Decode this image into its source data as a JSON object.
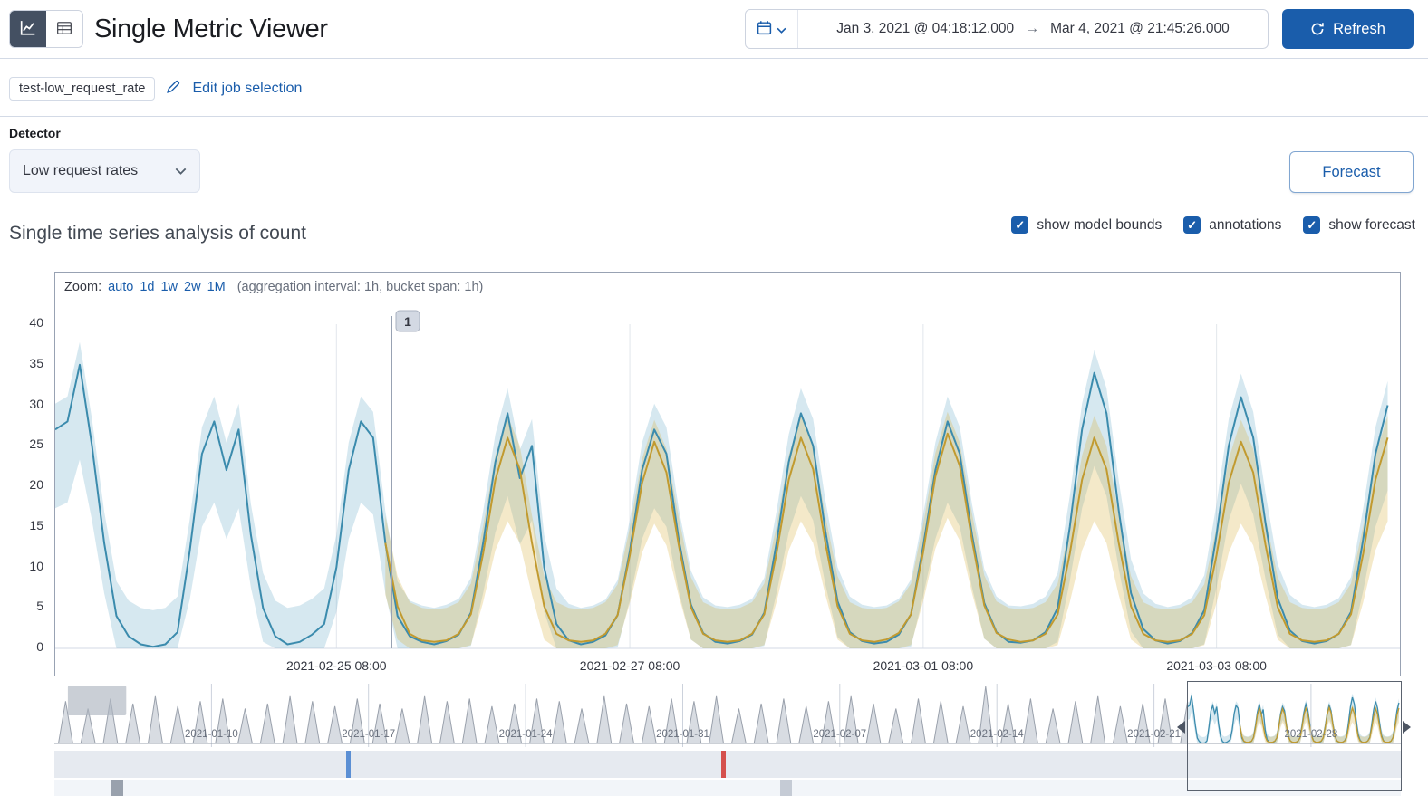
{
  "header": {
    "title": "Single Metric Viewer",
    "time_range": {
      "start": "Jan 3, 2021 @ 04:18:12.000",
      "arrow": "→",
      "end": "Mar 4, 2021 @ 21:45:26.000"
    },
    "refresh_label": "Refresh"
  },
  "job_bar": {
    "job_badge": "test-low_request_rate",
    "edit_link": "Edit job selection"
  },
  "detector": {
    "label": "Detector",
    "selected": "Low request rates"
  },
  "forecast_button_label": "Forecast",
  "series_section": {
    "title": "Single time series analysis of count",
    "checkboxes": [
      {
        "label": "show model bounds",
        "checked": true
      },
      {
        "label": "annotations",
        "checked": true
      },
      {
        "label": "show forecast",
        "checked": true
      }
    ]
  },
  "zoom_bar": {
    "prefix": "Zoom:",
    "links": [
      "auto",
      "1d",
      "1w",
      "2w",
      "1M"
    ],
    "suffix": "(aggregation interval: 1h, bucket span: 1h)"
  },
  "annotation": {
    "badge_label": "1"
  },
  "colors": {
    "primary": "#1a5dab",
    "actual_line": "#3b8bad",
    "model_band": "rgba(93,165,195,0.25)",
    "forecast_line": "#c19a2f",
    "forecast_band": "rgba(214,177,62,0.28)",
    "annotation_line": "#98a2b3",
    "gridline": "#e2e6ec",
    "context_fill": "#d8dce2",
    "context_stroke": "#9aa1ac",
    "marker_blue": "#5b8fd4",
    "marker_red": "#d5504c"
  },
  "chart_data": {
    "type": "line",
    "title": "Single time series analysis of count",
    "x_unit": "hours (bucket span 1h), window ≈ 2021-02-23 10:00 to 2021-03-04 16:00",
    "ylim": [
      0,
      40
    ],
    "y_ticks": [
      0,
      5,
      10,
      15,
      20,
      25,
      30,
      35,
      40
    ],
    "t_start": 0,
    "t_end": 220,
    "t_step": 2,
    "annotation_t": 55,
    "x_ticks": [
      {
        "t": 46,
        "label": "2021-02-25 08:00"
      },
      {
        "t": 94,
        "label": "2021-02-27 08:00"
      },
      {
        "t": 142,
        "label": "2021-03-01 08:00"
      },
      {
        "t": 190,
        "label": "2021-03-03 08:00"
      }
    ],
    "series": [
      {
        "name": "actual",
        "legend": "count",
        "values": [
          27,
          28,
          35,
          25,
          13,
          4,
          1.5,
          0.5,
          0.2,
          0.5,
          2,
          12,
          24,
          28,
          22,
          27,
          14,
          5,
          1.5,
          0.5,
          0.8,
          1.7,
          3,
          10,
          22,
          28,
          26,
          13,
          4,
          1.5,
          0.8,
          0.5,
          0.9,
          1.7,
          4.4,
          13,
          23,
          29,
          21,
          25,
          10,
          3,
          1,
          0.5,
          0.8,
          1.6,
          4.1,
          12,
          22,
          27,
          24,
          13.5,
          5.4,
          1.9,
          0.8,
          0.6,
          0.9,
          1.7,
          4.4,
          13,
          23,
          29,
          25,
          14.5,
          5.8,
          2,
          0.9,
          0.6,
          0.8,
          1.7,
          4.2,
          12.6,
          22,
          28,
          24,
          14,
          5.6,
          2,
          0.8,
          0.7,
          1,
          2,
          5,
          15,
          27,
          34,
          29,
          17,
          6.8,
          2.4,
          1,
          0.6,
          0.9,
          1.9,
          4.7,
          14,
          25,
          31,
          26,
          15.5,
          6.2,
          2.2,
          0.9,
          0.6,
          0.9,
          1.8,
          4.5,
          13.5,
          24,
          30
        ]
      },
      {
        "name": "model_upper",
        "legend": "model upper bound",
        "values": [
          30.2,
          31.1,
          37.8,
          28.3,
          16.9,
          8.3,
          5.9,
          5.0,
          4.7,
          5.0,
          6.4,
          15.9,
          27.3,
          31.1,
          25.4,
          30.2,
          17.8,
          9.3,
          5.9,
          5.0,
          5.3,
          6.1,
          7.4,
          14.0,
          25.4,
          31.1,
          29.2,
          16.9,
          8.3,
          5.9,
          5.3,
          5.0,
          5.4,
          6.1,
          8.7,
          16.9,
          26.4,
          32.1,
          24.5,
          28.3,
          14.0,
          7.4,
          5.5,
          5.0,
          5.3,
          6.0,
          8.4,
          15.9,
          25.4,
          30.2,
          27.3,
          17.3,
          9.6,
          6.3,
          5.3,
          5.1,
          5.4,
          6.1,
          8.7,
          16.9,
          26.4,
          32.1,
          28.3,
          18.3,
          10.0,
          6.4,
          5.4,
          5.1,
          5.3,
          6.1,
          8.5,
          16.5,
          25.4,
          31.1,
          27.3,
          17.8,
          9.8,
          6.4,
          5.3,
          5.2,
          5.5,
          6.4,
          9.3,
          18.8,
          30.2,
          36.8,
          32.1,
          20.7,
          11.0,
          6.8,
          5.5,
          5.1,
          5.4,
          6.3,
          9.0,
          17.8,
          28.3,
          33.9,
          29.2,
          19.2,
          10.4,
          6.6,
          5.4,
          5.1,
          5.4,
          6.2,
          8.8,
          17.3,
          27.3,
          33.0
        ]
      },
      {
        "name": "model_lower",
        "legend": "model lower bound",
        "values": [
          17.3,
          18.0,
          23.3,
          15.8,
          6.8,
          0,
          0,
          0,
          0,
          0,
          0,
          6.0,
          15.0,
          18.0,
          13.5,
          17.3,
          7.5,
          0.8,
          0,
          0,
          0,
          0,
          0,
          4.5,
          13.5,
          18.0,
          16.5,
          6.8,
          0,
          0,
          0,
          0,
          0,
          0,
          0.3,
          6.8,
          14.3,
          18.8,
          12.8,
          15.8,
          4.5,
          0,
          0,
          0,
          0,
          0,
          0.1,
          6.0,
          13.5,
          17.3,
          15.0,
          7.1,
          1.1,
          0,
          0,
          0,
          0,
          0,
          0.3,
          6.8,
          14.3,
          18.8,
          15.8,
          7.9,
          1.4,
          0,
          0,
          0,
          0,
          0,
          0.2,
          6.5,
          13.5,
          18.0,
          15.0,
          7.5,
          1.2,
          0,
          0,
          0,
          0,
          0,
          0.8,
          8.3,
          17.3,
          22.5,
          18.8,
          9.8,
          2.1,
          0,
          0,
          0,
          0,
          0,
          0.5,
          7.5,
          15.8,
          20.3,
          16.5,
          8.6,
          1.7,
          0,
          0,
          0,
          0,
          0,
          0.4,
          7.1,
          15.0,
          19.5
        ]
      },
      {
        "name": "forecast",
        "legend": "forecast",
        "start_t": 54,
        "values": [
          13,
          5.2,
          1.8,
          1.0,
          0.8,
          1.0,
          1.8,
          4.2,
          11.7,
          20.8,
          26,
          22.1,
          13,
          5.2,
          1.8,
          1.0,
          0.8,
          1.0,
          1.8,
          4.1,
          11.5,
          20.4,
          25.5,
          21.7,
          12.8,
          5.1,
          1.8,
          1.0,
          0.8,
          1.0,
          1.8,
          4.2,
          11.7,
          20.8,
          26,
          22.1,
          13,
          5.2,
          1.8,
          1.0,
          0.8,
          1.1,
          1.9,
          4.2,
          11.9,
          21.2,
          26.5,
          22.5,
          13.3,
          5.3,
          1.9,
          1.1,
          0.8,
          1.0,
          1.8,
          4.2,
          11.7,
          20.8,
          26,
          22.1,
          13,
          5.2,
          1.8,
          1.0,
          0.8,
          1.0,
          1.8,
          4.1,
          11.5,
          20.4,
          25.5,
          21.7,
          12.8,
          5.1,
          1.8,
          1.0,
          0.8,
          1.0,
          1.8,
          4.2,
          11.7,
          20.8,
          26
        ]
      },
      {
        "name": "forecast_upper",
        "legend": "forecast upper bound",
        "start_t": 54,
        "values": [
          16.4,
          8.9,
          5.7,
          5.0,
          4.8,
          5.0,
          5.7,
          8.0,
          15.1,
          23.8,
          28.7,
          25.0,
          16.4,
          8.9,
          5.7,
          5.0,
          4.8,
          5.0,
          5.7,
          7.9,
          14.9,
          23.4,
          28.2,
          24.6,
          16.2,
          8.8,
          5.7,
          5.0,
          4.8,
          5.0,
          5.7,
          8.0,
          15.1,
          23.8,
          28.7,
          25.0,
          16.4,
          8.9,
          5.7,
          5.0,
          4.8,
          5.0,
          5.8,
          8.0,
          15.3,
          24.1,
          29.2,
          25.4,
          16.6,
          9.0,
          5.8,
          5.0,
          4.8,
          5.0,
          5.7,
          8.0,
          15.1,
          23.8,
          28.7,
          25.0,
          16.4,
          8.9,
          5.7,
          5.0,
          4.8,
          5.0,
          5.7,
          7.9,
          14.9,
          23.4,
          28.2,
          24.6,
          16.2,
          8.8,
          5.7,
          5.0,
          4.8,
          5.0,
          5.7,
          8.0,
          15.1,
          23.8,
          28.7
        ]
      },
      {
        "name": "forecast_lower",
        "legend": "forecast lower bound",
        "start_t": 54,
        "values": [
          6.6,
          1.1,
          0,
          0,
          0,
          0,
          0,
          0.4,
          5.7,
          12.1,
          15.7,
          13.0,
          6.6,
          1.1,
          0,
          0,
          0,
          0,
          0,
          0.4,
          5.6,
          11.8,
          15.4,
          12.7,
          6.5,
          1.1,
          0,
          0,
          0,
          0,
          0,
          0.4,
          5.7,
          12.1,
          15.7,
          13.0,
          6.6,
          1.1,
          0,
          0,
          0,
          0,
          0,
          0.4,
          5.8,
          12.3,
          16.1,
          13.3,
          6.8,
          1.2,
          0,
          0,
          0,
          0,
          0,
          0.4,
          5.7,
          12.1,
          15.7,
          13.0,
          6.6,
          1.1,
          0,
          0,
          0,
          0,
          0,
          0.4,
          5.6,
          11.8,
          15.4,
          12.7,
          6.5,
          1.1,
          0,
          0,
          0,
          0,
          0,
          0.4,
          5.7,
          12.1,
          15.7
        ]
      }
    ],
    "context": {
      "days": 60,
      "x_ticks": [
        {
          "day": 7,
          "label": "2021-01-10"
        },
        {
          "day": 14,
          "label": "2021-01-17"
        },
        {
          "day": 21,
          "label": "2021-01-24"
        },
        {
          "day": 28,
          "label": "2021-01-31"
        },
        {
          "day": 35,
          "label": "2021-02-07"
        },
        {
          "day": 42,
          "label": "2021-02-14"
        },
        {
          "day": 49,
          "label": "2021-02-21"
        },
        {
          "day": 56,
          "label": "2021-02-28"
        }
      ],
      "peak_amplitudes": [
        0.85,
        0.7,
        0.9,
        0.8,
        0.95,
        0.75,
        0.85,
        0.9,
        0.7,
        0.8,
        0.95,
        0.85,
        0.75,
        0.9,
        0.8,
        0.7,
        0.95,
        0.85,
        0.9,
        0.75,
        0.8,
        0.9,
        0.85,
        0.7,
        0.95,
        0.8,
        0.75,
        0.9,
        0.85,
        0.95,
        0.7,
        0.8,
        0.9,
        0.75,
        0.85,
        0.95,
        0.8,
        0.7,
        0.9,
        0.85,
        0.75,
        1.35,
        0.8,
        0.9,
        0.7,
        0.85,
        0.95,
        0.75,
        0.8,
        0.9,
        0.85,
        0.7,
        0.95,
        0.8,
        0.9,
        0.75,
        0.85,
        0.9,
        0.8,
        0.95
      ],
      "annotation_region": {
        "start_day": 0.6,
        "end_day": 3.2
      },
      "selection": {
        "start_day": 50.5,
        "end_day": 60
      },
      "annotation_markers": [
        {
          "day": 13.1,
          "color": "#5b8fd4"
        },
        {
          "day": 29.8,
          "color": "#d5504c"
        }
      ],
      "swimlane_markers": [
        {
          "day": 2.8,
          "color": "#99a1ad"
        },
        {
          "day": 32.6,
          "color": "#c5cbd5"
        }
      ]
    }
  }
}
